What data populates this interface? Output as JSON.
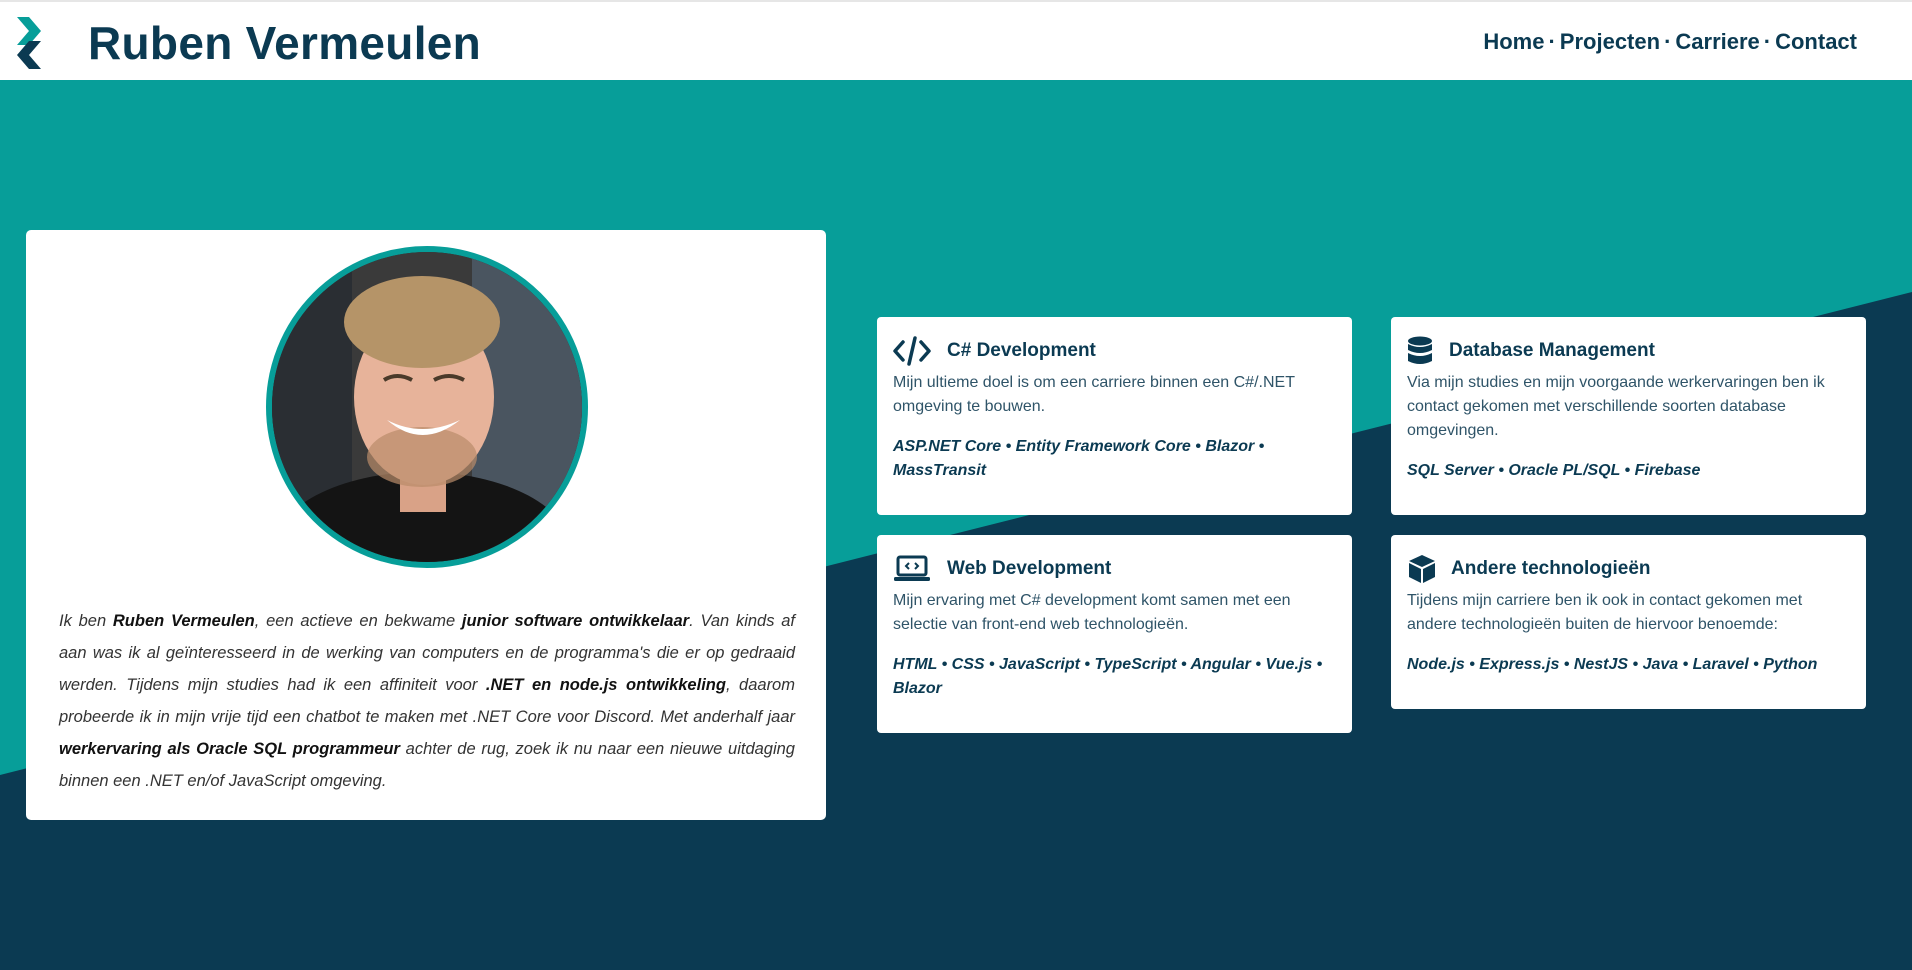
{
  "site": {
    "title": "Ruben Vermeulen"
  },
  "nav": {
    "items": [
      "Home",
      "Projecten",
      "Carriere",
      "Contact"
    ],
    "separator": "·"
  },
  "colors": {
    "teal": "#079e99",
    "navy": "#0b3a52",
    "white": "#ffffff"
  },
  "about": {
    "segments": [
      {
        "text": "Ik ben ",
        "bold": false
      },
      {
        "text": "Ruben Vermeulen",
        "bold": true
      },
      {
        "text": ", een actieve en bekwame ",
        "bold": false
      },
      {
        "text": "junior software ontwikkelaar",
        "bold": true
      },
      {
        "text": ". Van kinds af aan was ik al geïnteresseerd in de werking van computers en de programma's die er op gedraaid werden. Tijdens mijn studies had ik een affiniteit voor ",
        "bold": false
      },
      {
        "text": ".NET en node.js ontwikkeling",
        "bold": true
      },
      {
        "text": ", daarom probeerde ik in mijn vrije tijd een chatbot te maken met .NET Core voor Discord. Met anderhalf jaar ",
        "bold": false
      },
      {
        "text": "werkervaring als Oracle SQL programmeur",
        "bold": true
      },
      {
        "text": " achter de rug, zoek ik nu naar een nieuwe uitdaging binnen een .NET en/of JavaScript omgeving.",
        "bold": false
      }
    ]
  },
  "skills": [
    {
      "icon": "code-icon",
      "title": "C# Development",
      "description": "Mijn ultieme doel is om een carriere binnen een C#/.NET omgeving te bouwen.",
      "technologies": "ASP.NET Core • Entity Framework Core • Blazor • MassTransit"
    },
    {
      "icon": "database-icon",
      "title": "Database Management",
      "description": "Via mijn studies en mijn voorgaande werkervaringen ben ik contact gekomen met verschillende soorten database omgevingen.",
      "technologies": "SQL Server • Oracle PL/SQL • Firebase"
    },
    {
      "icon": "laptop-code-icon",
      "title": "Web Development",
      "description": "Mijn ervaring met C# development komt samen met een selectie van front-end web technologieën.",
      "technologies": "HTML • CSS • JavaScript • TypeScript • Angular • Vue.js • Blazor"
    },
    {
      "icon": "cube-icon",
      "title": "Andere technologieën",
      "description": "Tijdens mijn carriere ben ik ook in contact gekomen met andere technologieën buiten de hiervoor benoemde:",
      "technologies": "Node.js • Express.js • NestJS • Java • Laravel • Python"
    }
  ]
}
